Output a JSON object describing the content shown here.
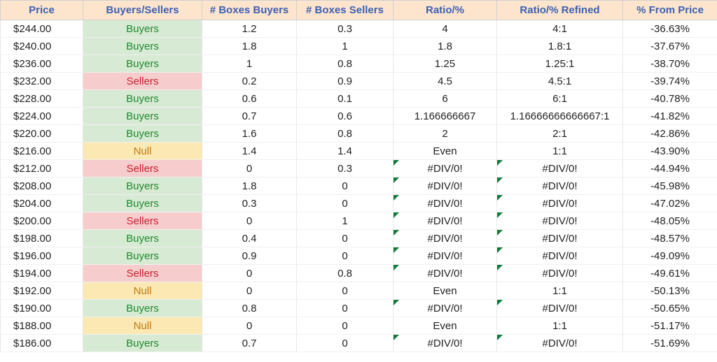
{
  "headers": {
    "price": "Price",
    "bs": "Buyers/Sellers",
    "boxes_buyers": "# Boxes Buyers",
    "boxes_sellers": "# Boxes Sellers",
    "ratio": "Ratio/%",
    "ratio_ref": "Ratio/% Refined",
    "pct_from_price": "% From Price"
  },
  "status_labels": {
    "Buyers": "Buyers",
    "Sellers": "Sellers",
    "Null": "Null"
  },
  "rows": [
    {
      "price": "$244.00",
      "bs": "Buyers",
      "boxes_buyers": "1.2",
      "boxes_sellers": "0.3",
      "ratio": "4",
      "ratio_err": false,
      "ratio_ref": "4:1",
      "ratio_ref_err": false,
      "pct": "-36.63%"
    },
    {
      "price": "$240.00",
      "bs": "Buyers",
      "boxes_buyers": "1.8",
      "boxes_sellers": "1",
      "ratio": "1.8",
      "ratio_err": false,
      "ratio_ref": "1.8:1",
      "ratio_ref_err": false,
      "pct": "-37.67%"
    },
    {
      "price": "$236.00",
      "bs": "Buyers",
      "boxes_buyers": "1",
      "boxes_sellers": "0.8",
      "ratio": "1.25",
      "ratio_err": false,
      "ratio_ref": "1.25:1",
      "ratio_ref_err": false,
      "pct": "-38.70%"
    },
    {
      "price": "$232.00",
      "bs": "Sellers",
      "boxes_buyers": "0.2",
      "boxes_sellers": "0.9",
      "ratio": "4.5",
      "ratio_err": false,
      "ratio_ref": "4.5:1",
      "ratio_ref_err": false,
      "pct": "-39.74%"
    },
    {
      "price": "$228.00",
      "bs": "Buyers",
      "boxes_buyers": "0.6",
      "boxes_sellers": "0.1",
      "ratio": "6",
      "ratio_err": false,
      "ratio_ref": "6:1",
      "ratio_ref_err": false,
      "pct": "-40.78%"
    },
    {
      "price": "$224.00",
      "bs": "Buyers",
      "boxes_buyers": "0.7",
      "boxes_sellers": "0.6",
      "ratio": "1.166666667",
      "ratio_err": false,
      "ratio_ref": "1.16666666666667:1",
      "ratio_ref_err": false,
      "pct": "-41.82%"
    },
    {
      "price": "$220.00",
      "bs": "Buyers",
      "boxes_buyers": "1.6",
      "boxes_sellers": "0.8",
      "ratio": "2",
      "ratio_err": false,
      "ratio_ref": "2:1",
      "ratio_ref_err": false,
      "pct": "-42.86%"
    },
    {
      "price": "$216.00",
      "bs": "Null",
      "boxes_buyers": "1.4",
      "boxes_sellers": "1.4",
      "ratio": "Even",
      "ratio_err": false,
      "ratio_ref": "1:1",
      "ratio_ref_err": false,
      "pct": "-43.90%"
    },
    {
      "price": "$212.00",
      "bs": "Sellers",
      "boxes_buyers": "0",
      "boxes_sellers": "0.3",
      "ratio": "#DIV/0!",
      "ratio_err": true,
      "ratio_ref": "#DIV/0!",
      "ratio_ref_err": true,
      "pct": "-44.94%"
    },
    {
      "price": "$208.00",
      "bs": "Buyers",
      "boxes_buyers": "1.8",
      "boxes_sellers": "0",
      "ratio": "#DIV/0!",
      "ratio_err": true,
      "ratio_ref": "#DIV/0!",
      "ratio_ref_err": true,
      "pct": "-45.98%"
    },
    {
      "price": "$204.00",
      "bs": "Buyers",
      "boxes_buyers": "0.3",
      "boxes_sellers": "0",
      "ratio": "#DIV/0!",
      "ratio_err": true,
      "ratio_ref": "#DIV/0!",
      "ratio_ref_err": true,
      "pct": "-47.02%"
    },
    {
      "price": "$200.00",
      "bs": "Sellers",
      "boxes_buyers": "0",
      "boxes_sellers": "1",
      "ratio": "#DIV/0!",
      "ratio_err": true,
      "ratio_ref": "#DIV/0!",
      "ratio_ref_err": true,
      "pct": "-48.05%"
    },
    {
      "price": "$198.00",
      "bs": "Buyers",
      "boxes_buyers": "0.4",
      "boxes_sellers": "0",
      "ratio": "#DIV/0!",
      "ratio_err": true,
      "ratio_ref": "#DIV/0!",
      "ratio_ref_err": true,
      "pct": "-48.57%"
    },
    {
      "price": "$196.00",
      "bs": "Buyers",
      "boxes_buyers": "0.9",
      "boxes_sellers": "0",
      "ratio": "#DIV/0!",
      "ratio_err": true,
      "ratio_ref": "#DIV/0!",
      "ratio_ref_err": true,
      "pct": "-49.09%"
    },
    {
      "price": "$194.00",
      "bs": "Sellers",
      "boxes_buyers": "0",
      "boxes_sellers": "0.8",
      "ratio": "#DIV/0!",
      "ratio_err": true,
      "ratio_ref": "#DIV/0!",
      "ratio_ref_err": true,
      "pct": "-49.61%"
    },
    {
      "price": "$192.00",
      "bs": "Null",
      "boxes_buyers": "0",
      "boxes_sellers": "0",
      "ratio": "Even",
      "ratio_err": false,
      "ratio_ref": "1:1",
      "ratio_ref_err": false,
      "pct": "-50.13%"
    },
    {
      "price": "$190.00",
      "bs": "Buyers",
      "boxes_buyers": "0.8",
      "boxes_sellers": "0",
      "ratio": "#DIV/0!",
      "ratio_err": true,
      "ratio_ref": "#DIV/0!",
      "ratio_ref_err": true,
      "pct": "-50.65%"
    },
    {
      "price": "$188.00",
      "bs": "Null",
      "boxes_buyers": "0",
      "boxes_sellers": "0",
      "ratio": "Even",
      "ratio_err": false,
      "ratio_ref": "1:1",
      "ratio_ref_err": false,
      "pct": "-51.17%"
    },
    {
      "price": "$186.00",
      "bs": "Buyers",
      "boxes_buyers": "0.7",
      "boxes_sellers": "0",
      "ratio": "#DIV/0!",
      "ratio_err": true,
      "ratio_ref": "#DIV/0!",
      "ratio_ref_err": true,
      "pct": "-51.69%"
    }
  ]
}
